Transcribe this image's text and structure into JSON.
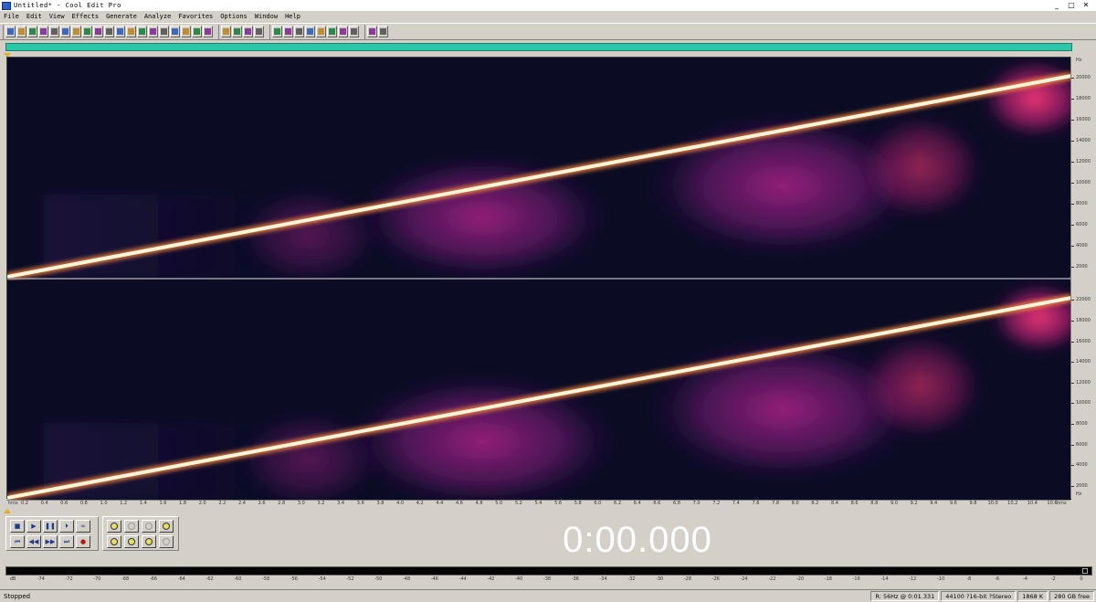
{
  "window": {
    "title": "Untitled* - Cool Edit Pro",
    "buttons": [
      "_",
      "□",
      "✕"
    ]
  },
  "menu": [
    "File",
    "Edit",
    "View",
    "Effects",
    "Generate",
    "Analyze",
    "Favorites",
    "Options",
    "Window",
    "Help"
  ],
  "toolbar": {
    "groups": [
      [
        "new-icon",
        "open-icon",
        "save-icon",
        "save-all-icon",
        "close-icon",
        "cut-icon",
        "copy-icon",
        "paste-icon",
        "mix-paste-icon",
        "undo-icon",
        "trim-icon",
        "delete-icon",
        "select-icon",
        "mix-icon",
        "loop-icon",
        "insert-icon",
        "mono-icon",
        "record-icon",
        "play-icon"
      ],
      [
        "waveform-view-icon",
        "spectral-view-icon",
        "pan-view-icon",
        "phase-view-icon"
      ],
      [
        "snap-icon",
        "grid-icon",
        "cue-icon",
        "range-icon",
        "find-icon",
        "zoom-fit-icon",
        "marker-icon",
        "region-icon"
      ],
      [
        "favorites-icon",
        "help-icon"
      ]
    ]
  },
  "spectrogram": {
    "y_unit": "Hz",
    "ch1_ticks": [
      "20000",
      "18000",
      "16000",
      "14000",
      "12000",
      "10000",
      "8000",
      "6000",
      "4000",
      "2000"
    ],
    "ch2_ticks": [
      "22000",
      "18000",
      "16000",
      "14000",
      "12000",
      "10000",
      "8000",
      "6000",
      "4000",
      "2000"
    ],
    "x_unit_start": "hms",
    "x_ticks": [
      "0.2",
      "0.4",
      "0.6",
      "0.8",
      "1.0",
      "1.2",
      "1.4",
      "1.6",
      "1.8",
      "2.0",
      "2.2",
      "2.4",
      "2.6",
      "2.8",
      "3.0",
      "3.2",
      "3.4",
      "3.6",
      "3.8",
      "4.0",
      "4.2",
      "4.4",
      "4.6",
      "4.8",
      "5.0",
      "5.2",
      "5.4",
      "5.6",
      "5.8",
      "6.0",
      "6.2",
      "6.4",
      "6.6",
      "6.8",
      "7.0",
      "7.2",
      "7.4",
      "7.6",
      "7.8",
      "8.0",
      "8.2",
      "8.4",
      "8.6",
      "8.8",
      "9.0",
      "9.2",
      "9.4",
      "9.6",
      "9.8",
      "10.0",
      "10.2",
      "10.4",
      "10.6"
    ],
    "x_unit_end": "hms"
  },
  "transport": {
    "row1": [
      "■",
      "▶",
      "❚❚",
      "⏵",
      "∞"
    ],
    "row2": [
      "⏮",
      "◀◀",
      "▶▶",
      "⏭",
      "●"
    ],
    "row1_names": [
      "stop-button",
      "play-button",
      "pause-button",
      "play-to-end-button",
      "loop-play-button"
    ],
    "row2_names": [
      "go-start-button",
      "rewind-button",
      "fast-forward-button",
      "go-end-button",
      "record-button"
    ]
  },
  "zoom": {
    "row1_names": [
      "zoom-in-vertical-button",
      "zoom-out-vertical-button",
      "zoom-full-button",
      "zoom-in-button"
    ],
    "row2_names": [
      "zoom-in-left-button",
      "zoom-in-right-button",
      "zoom-out-button",
      "zoom-selection-button"
    ]
  },
  "time_display": "0:00.000",
  "meter_ticks": [
    "dB",
    "-74",
    "-72",
    "-70",
    "-68",
    "-66",
    "-64",
    "-62",
    "-60",
    "-58",
    "-56",
    "-54",
    "-52",
    "-50",
    "-48",
    "-46",
    "-44",
    "-42",
    "-40",
    "-38",
    "-36",
    "-34",
    "-32",
    "-30",
    "-28",
    "-26",
    "-24",
    "-22",
    "-20",
    "-18",
    "-16",
    "-14",
    "-12",
    "-10",
    "-8",
    "-6",
    "-4",
    "-2",
    "0"
  ],
  "status": {
    "state": "Stopped",
    "cells": [
      "R: 56Hz @ 0:01.331",
      "44100 ?16-bit ?Stereo",
      "1868 K",
      "280 GB free"
    ]
  },
  "colors": {
    "sweep": "#ffe6b0",
    "background": "#0b0c24",
    "band": "#a0207a",
    "overview": "#28c8a8"
  }
}
